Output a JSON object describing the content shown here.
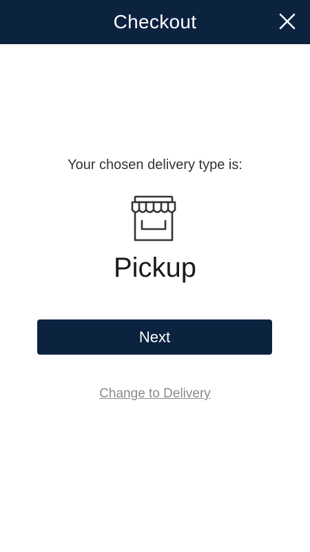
{
  "header": {
    "title": "Checkout",
    "close_icon": "close-icon"
  },
  "main": {
    "prompt": "Your chosen delivery type is:",
    "type_icon": "storefront-icon",
    "delivery_type": "Pickup",
    "next_label": "Next",
    "change_link": "Change to Delivery"
  },
  "colors": {
    "header_bg": "#0c2340",
    "button_bg": "#0c2340",
    "link": "#8a8a8a"
  }
}
